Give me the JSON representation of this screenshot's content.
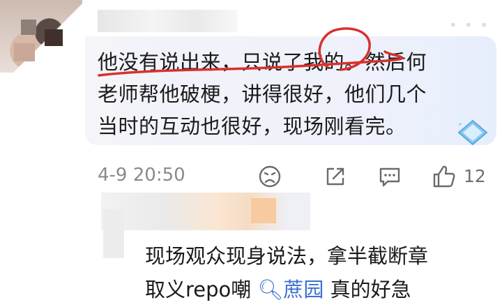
{
  "comment": {
    "lines": [
      "他没有说出来，只说了我的。然后何",
      "老师帮他破梗，讲得很好，他们几个",
      "当时的互动也很好，现场刚看完。"
    ],
    "timestamp": "4-9 20:50",
    "like_count": "12"
  },
  "reply": {
    "line1": "现场观众现身说法，拿半截断章",
    "line2_prefix": "取义repo嘲",
    "topic_icon": "search-icon",
    "topic": "蔗园",
    "line2_suffix": "真的好急"
  },
  "colors": {
    "annotation_red": "#d9302c",
    "topic_blue": "#3d6fd1"
  },
  "icons": [
    "dislike-face-icon",
    "share-icon",
    "comment-icon",
    "thumbs-up-icon",
    "diamond-badge-icon"
  ]
}
